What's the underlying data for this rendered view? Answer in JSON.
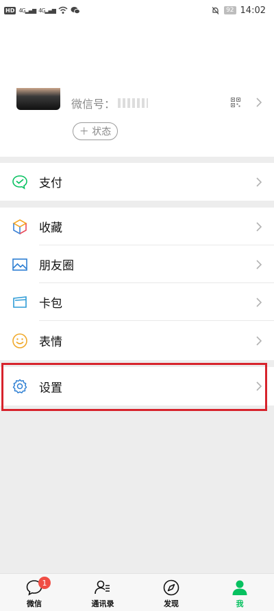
{
  "status_bar": {
    "left_chip": "HD",
    "sig1": "4G",
    "sig2": "4G",
    "battery": "92",
    "time": "14:02"
  },
  "profile": {
    "wechat_id_label": "微信号：",
    "status_button": "＋ 状态"
  },
  "menu": {
    "pay": "支付",
    "favorites": "收藏",
    "moments": "朋友圈",
    "cards": "卡包",
    "stickers": "表情",
    "settings": "设置"
  },
  "tabbar": {
    "chats": "微信",
    "chats_badge": "1",
    "contacts": "通讯录",
    "discover": "发现",
    "me": "我"
  },
  "colors": {
    "accent": "#07c160",
    "highlight": "#d7232c",
    "badge": "#f04d44"
  }
}
